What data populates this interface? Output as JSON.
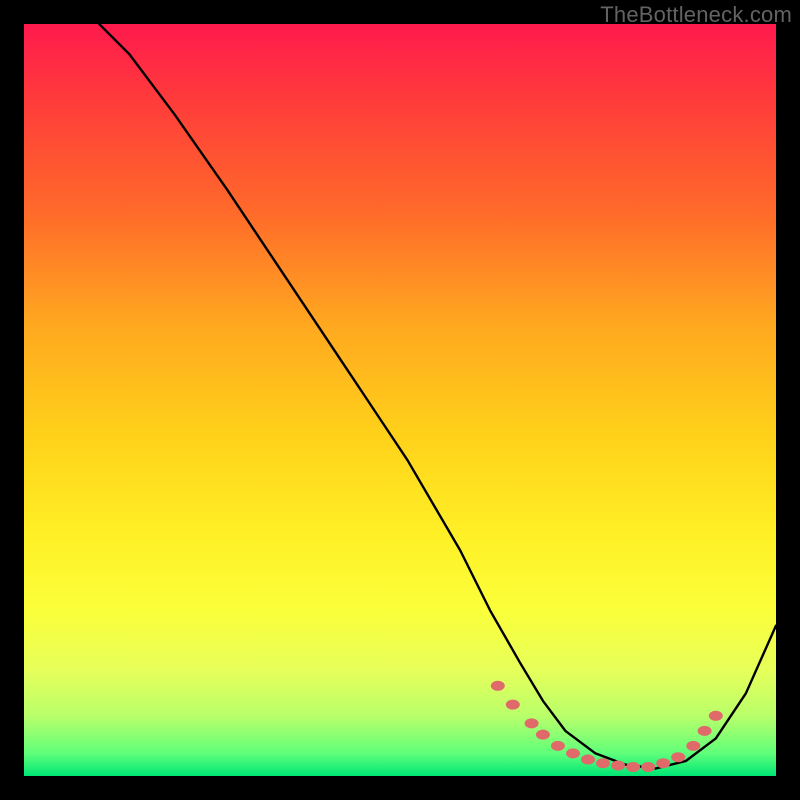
{
  "watermark": "TheBottleneck.com",
  "chart_data": {
    "type": "line",
    "title": "",
    "xlabel": "",
    "ylabel": "",
    "xlim": [
      0,
      100
    ],
    "ylim": [
      0,
      100
    ],
    "series": [
      {
        "name": "bottleneck-curve",
        "x": [
          10,
          14,
          20,
          27,
          35,
          43,
          51,
          58,
          62,
          66,
          69,
          72,
          76,
          80,
          84,
          88,
          92,
          96,
          100
        ],
        "y": [
          100,
          96,
          88,
          78,
          66,
          54,
          42,
          30,
          22,
          15,
          10,
          6,
          3,
          1.5,
          1,
          2,
          5,
          11,
          20
        ]
      }
    ],
    "markers": {
      "name": "highlight-dots",
      "color": "#e06a6a",
      "points": [
        {
          "x": 63,
          "y": 12
        },
        {
          "x": 65,
          "y": 9.5
        },
        {
          "x": 67.5,
          "y": 7
        },
        {
          "x": 69,
          "y": 5.5
        },
        {
          "x": 71,
          "y": 4
        },
        {
          "x": 73,
          "y": 3
        },
        {
          "x": 75,
          "y": 2.2
        },
        {
          "x": 77,
          "y": 1.7
        },
        {
          "x": 79,
          "y": 1.4
        },
        {
          "x": 81,
          "y": 1.2
        },
        {
          "x": 83,
          "y": 1.2
        },
        {
          "x": 85,
          "y": 1.7
        },
        {
          "x": 87,
          "y": 2.5
        },
        {
          "x": 89,
          "y": 4
        },
        {
          "x": 90.5,
          "y": 6
        },
        {
          "x": 92,
          "y": 8
        }
      ]
    },
    "background_gradient": {
      "top": "#ff1a4d",
      "mid": "#ffd21a",
      "bottom": "#00e676"
    }
  }
}
